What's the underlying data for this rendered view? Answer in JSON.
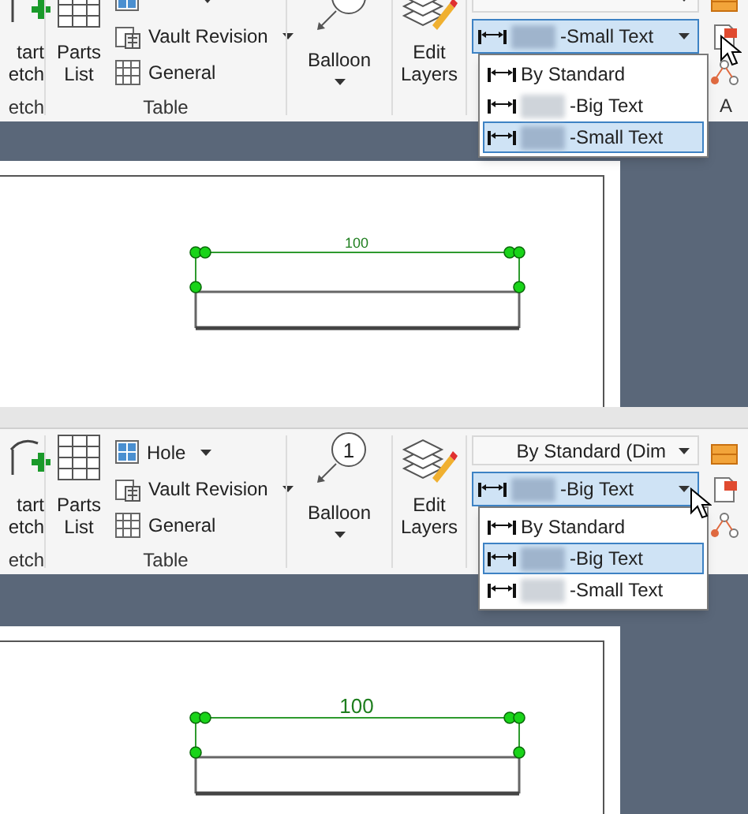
{
  "panels": [
    {
      "ribbon": {
        "sketch_button": [
          "tart",
          "etch"
        ],
        "sketch_group": "etch",
        "parts_list": [
          "Parts",
          "List"
        ],
        "stack": [
          {
            "dropdown": true
          },
          {
            "label": "Vault Revision",
            "dropdown": true
          },
          {
            "label": "General",
            "dropdown": false
          }
        ],
        "table_group": "Table",
        "balloon": {
          "label": "Balloon"
        },
        "edit_layers": [
          "Edit",
          "Layers"
        ],
        "layer_combo": {
          "value": "-Small Text",
          "redacted": true
        },
        "right_group_label": "A"
      },
      "layer_list": [
        {
          "label": "By Standard",
          "redacted": false,
          "selected": false
        },
        {
          "label": "-Big Text",
          "redacted": true,
          "selected": false
        },
        {
          "label": "-Small Text",
          "redacted": true,
          "selected": true
        }
      ],
      "dimension": {
        "value": "100",
        "kind": "small_text"
      }
    },
    {
      "ribbon": {
        "sketch_button": [
          "tart",
          "etch"
        ],
        "sketch_group": "etch",
        "parts_list": [
          "Parts",
          "List"
        ],
        "stack": [
          {
            "label": "Hole",
            "dropdown": true
          },
          {
            "label": "Vault Revision",
            "dropdown": true
          },
          {
            "label": "General",
            "dropdown": false
          }
        ],
        "table_group": "Table",
        "balloon": {
          "mark": "1",
          "label": "Balloon"
        },
        "edit_layers": [
          "Edit",
          "Layers"
        ],
        "standard_combo": "By Standard (Dim",
        "layer_combo": {
          "value": "-Big Text",
          "redacted": true
        }
      },
      "layer_list": [
        {
          "label": "By Standard",
          "redacted": false,
          "selected": false
        },
        {
          "label": "-Big Text",
          "redacted": true,
          "selected": true
        },
        {
          "label": "-Small Text",
          "redacted": true,
          "selected": false
        }
      ],
      "dimension": {
        "value": "100",
        "kind": "big_text"
      }
    }
  ]
}
